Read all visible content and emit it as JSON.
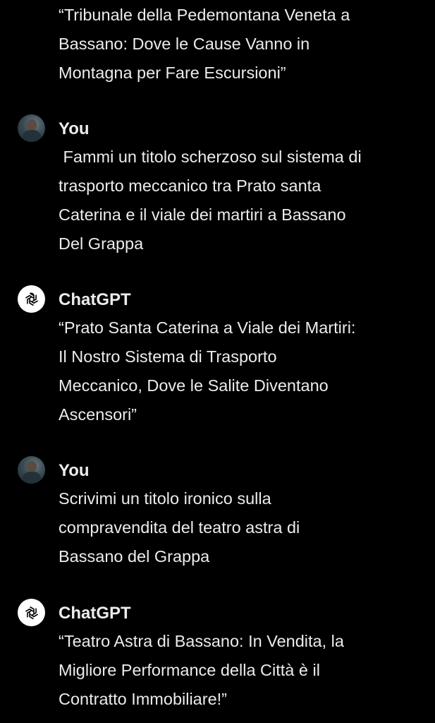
{
  "conversation": {
    "partial_top": {
      "lines": [
        "“Tribunale della Pedemontana Veneta a",
        "Bassano: Dove le Cause Vanno in",
        "Montagna per Fare Escursioni”"
      ]
    },
    "messages": [
      {
        "author": "You",
        "avatar_icon": "user-photo-avatar",
        "lines": [
          " Fammi un titolo scherzoso sul sistema di",
          "trasporto meccanico tra Prato santa",
          "Caterina e il viale dei martiri a Bassano",
          "Del Grappa"
        ]
      },
      {
        "author": "ChatGPT",
        "avatar_icon": "openai-logo-icon",
        "lines": [
          "“Prato Santa Caterina a Viale dei Martiri:",
          "Il Nostro Sistema di Trasporto",
          "Meccanico, Dove le Salite Diventano",
          "Ascensori”"
        ]
      },
      {
        "author": "You",
        "avatar_icon": "user-photo-avatar",
        "lines": [
          "Scrivimi un titolo ironico sulla",
          "compravendita del teatro astra di",
          "Bassano del Grappa"
        ]
      },
      {
        "author": "ChatGPT",
        "avatar_icon": "openai-logo-icon",
        "lines": [
          "“Teatro Astra di Bassano: In Vendita, la",
          "Migliore Performance della Città è il",
          "Contratto Immobiliare!”"
        ]
      }
    ]
  },
  "colors": {
    "background": "#000000",
    "text": "#ececec",
    "gpt_avatar_bg": "#ffffff"
  }
}
